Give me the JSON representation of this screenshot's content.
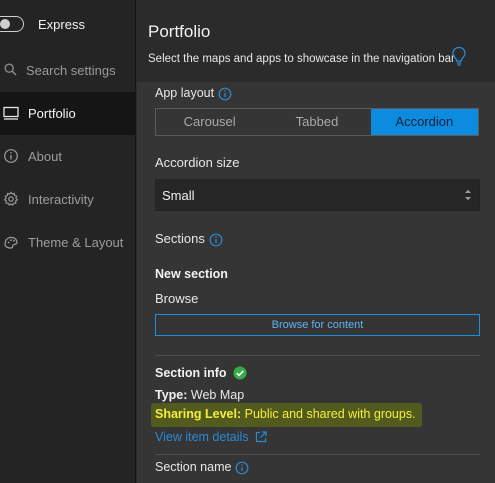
{
  "sidebar": {
    "express_label": "Express",
    "express_toggle_on": false,
    "search_placeholder": "Search settings",
    "items": [
      {
        "label": "Portfolio",
        "icon": "monitor-icon",
        "active": true
      },
      {
        "label": "About",
        "icon": "info-circle-icon",
        "active": false
      },
      {
        "label": "Interactivity",
        "icon": "gear-icon",
        "active": false
      },
      {
        "label": "Theme & Layout",
        "icon": "palette-icon",
        "active": false
      }
    ]
  },
  "panel": {
    "title": "Portfolio",
    "description": "Select the maps and apps to showcase in the navigation bar",
    "app_layout_label": "App layout",
    "layout_options": [
      "Carousel",
      "Tabbed",
      "Accordion"
    ],
    "layout_selected": "Accordion",
    "accordion_size_label": "Accordion size",
    "accordion_size_value": "Small",
    "sections_label": "Sections",
    "new_section_label": "New section",
    "browse_label": "Browse",
    "browse_button": "Browse for content",
    "section_info_label": "Section info",
    "type_label": "Type:",
    "type_value": "Web Map",
    "sharing_label": "Sharing Level:",
    "sharing_value": "Public and shared with groups.",
    "view_details_link": "View item details",
    "section_name_label": "Section name"
  },
  "colors": {
    "accent": "#0d8bde",
    "link": "#2a8ad4",
    "success": "#35ac46",
    "highlight_text": "#f4f03a"
  }
}
